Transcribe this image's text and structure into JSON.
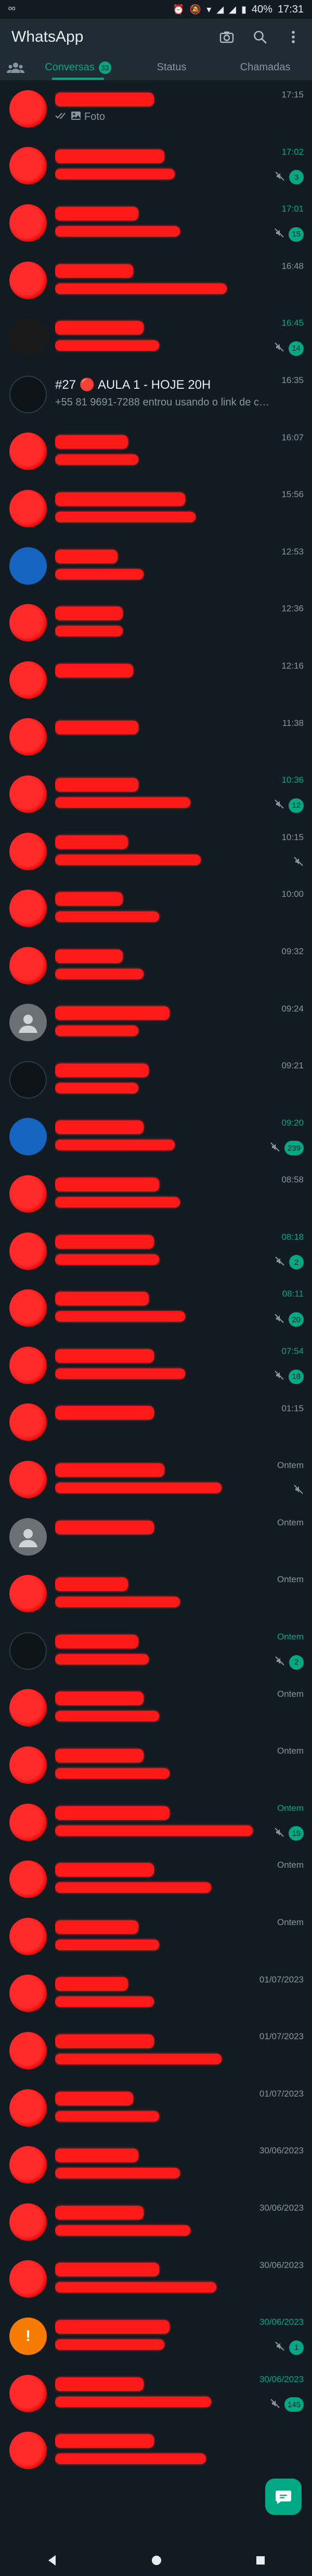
{
  "status_bar": {
    "time": "17:31",
    "battery": "40%"
  },
  "app": {
    "title": "WhatsApp"
  },
  "tabs": [
    {
      "label": "Conversas",
      "count": "33"
    },
    {
      "label": "Status"
    },
    {
      "label": "Chamadas"
    }
  ],
  "colors": {
    "accent": "#00a884",
    "background": "#111b21",
    "redaction": "#ff1a1a"
  },
  "chats": [
    {
      "time": "17:15",
      "snippet": "Foto",
      "snippet_icon": "photo-icon",
      "ticks": true,
      "avatar": "red"
    },
    {
      "time": "17:02",
      "unread": "3",
      "muted": true,
      "avatar": "red"
    },
    {
      "time": "17:01",
      "unread": "15",
      "muted": true,
      "avatar": "red"
    },
    {
      "time": "16:48",
      "avatar": "red"
    },
    {
      "time": "16:45",
      "unread": "14",
      "muted": true,
      "avatar": "gold"
    },
    {
      "time": "16:35",
      "name": "#27 🔴 AULA 1 - HOJE 20H",
      "snippet": "+55 81 9691-7288 entrou usando o link de c…",
      "avatar": "dark"
    },
    {
      "time": "16:07",
      "avatar": "red"
    },
    {
      "time": "15:56",
      "avatar": "red"
    },
    {
      "time": "12:53",
      "avatar": "blue"
    },
    {
      "time": "12:36",
      "avatar": "red"
    },
    {
      "time": "12:16",
      "avatar": "red"
    },
    {
      "time": "11:38",
      "avatar": "red"
    },
    {
      "time": "10:36",
      "unread": "12",
      "muted": true,
      "avatar": "red"
    },
    {
      "time": "10:15",
      "muted": true,
      "avatar": "red"
    },
    {
      "time": "10:00",
      "avatar": "red"
    },
    {
      "time": "09:32",
      "avatar": "red"
    },
    {
      "time": "09:24",
      "avatar": "grey"
    },
    {
      "time": "09:21",
      "avatar": "dark"
    },
    {
      "time": "09:20",
      "unread": "239",
      "muted": true,
      "avatar": "blue"
    },
    {
      "time": "08:58",
      "avatar": "red"
    },
    {
      "time": "08:18",
      "unread": "2",
      "muted": true,
      "avatar": "red"
    },
    {
      "time": "08:11",
      "unread": "20",
      "muted": true,
      "avatar": "red"
    },
    {
      "time": "07:54",
      "unread": "18",
      "muted": true,
      "avatar": "red"
    },
    {
      "time": "01:15",
      "avatar": "red"
    },
    {
      "time": "Ontem",
      "muted": true,
      "avatar": "red"
    },
    {
      "time": "Ontem",
      "avatar": "grey"
    },
    {
      "time": "Ontem",
      "avatar": "red"
    },
    {
      "time": "Ontem",
      "unread": "2",
      "muted": true,
      "avatar": "dark"
    },
    {
      "time": "Ontem",
      "avatar": "red"
    },
    {
      "time": "Ontem",
      "avatar": "red"
    },
    {
      "time": "Ontem",
      "unread": "15",
      "muted": true,
      "avatar": "red"
    },
    {
      "time": "Ontem",
      "avatar": "red"
    },
    {
      "time": "Ontem",
      "avatar": "red"
    },
    {
      "time": "01/07/2023",
      "avatar": "red"
    },
    {
      "time": "01/07/2023",
      "avatar": "red"
    },
    {
      "time": "01/07/2023",
      "avatar": "red"
    },
    {
      "time": "30/06/2023",
      "avatar": "red"
    },
    {
      "time": "30/06/2023",
      "avatar": "red"
    },
    {
      "time": "30/06/2023",
      "avatar": "red"
    },
    {
      "time": "30/06/2023",
      "unread": "1",
      "muted": true,
      "avatar": "orange"
    },
    {
      "time": "30/06/2023",
      "unread": "145",
      "muted": true,
      "avatar": "red"
    },
    {
      "time": "",
      "avatar": "red"
    }
  ]
}
